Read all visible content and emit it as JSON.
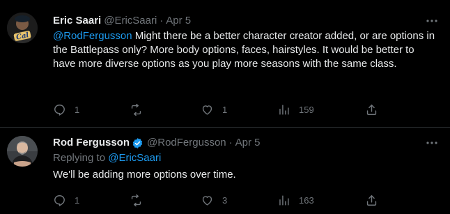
{
  "tweets": [
    {
      "author": "Eric Saari",
      "handle": "@EricSaari",
      "separator": "·",
      "date": "Apr 5",
      "mention": "@RodFergusson",
      "text": " Might there be a better character creator added, or are options in the Battlepass only? More body options, faces, hairstyles. It would be better to have more diverse options as you play more seasons with the same class.",
      "avatar_text": "Cal",
      "replies": "1",
      "reposts": "",
      "likes": "1",
      "views": "159"
    },
    {
      "author": "Rod Fergusson",
      "handle": "@RodFergusson",
      "separator": "·",
      "date": "Apr 5",
      "replying_prefix": "Replying to",
      "replying_to": "@EricSaari",
      "text": "We'll be adding more options over time.",
      "replies": "1",
      "reposts": "",
      "likes": "3",
      "views": "163"
    }
  ],
  "colors": {
    "background": "#000000",
    "text": "#e7e9ea",
    "muted": "#71767b",
    "accent": "#1d9bf0",
    "divider": "#2f3336"
  },
  "icons": [
    "reply-icon",
    "repost-icon",
    "like-icon",
    "views-icon",
    "share-icon",
    "more-icon",
    "verified-icon"
  ]
}
